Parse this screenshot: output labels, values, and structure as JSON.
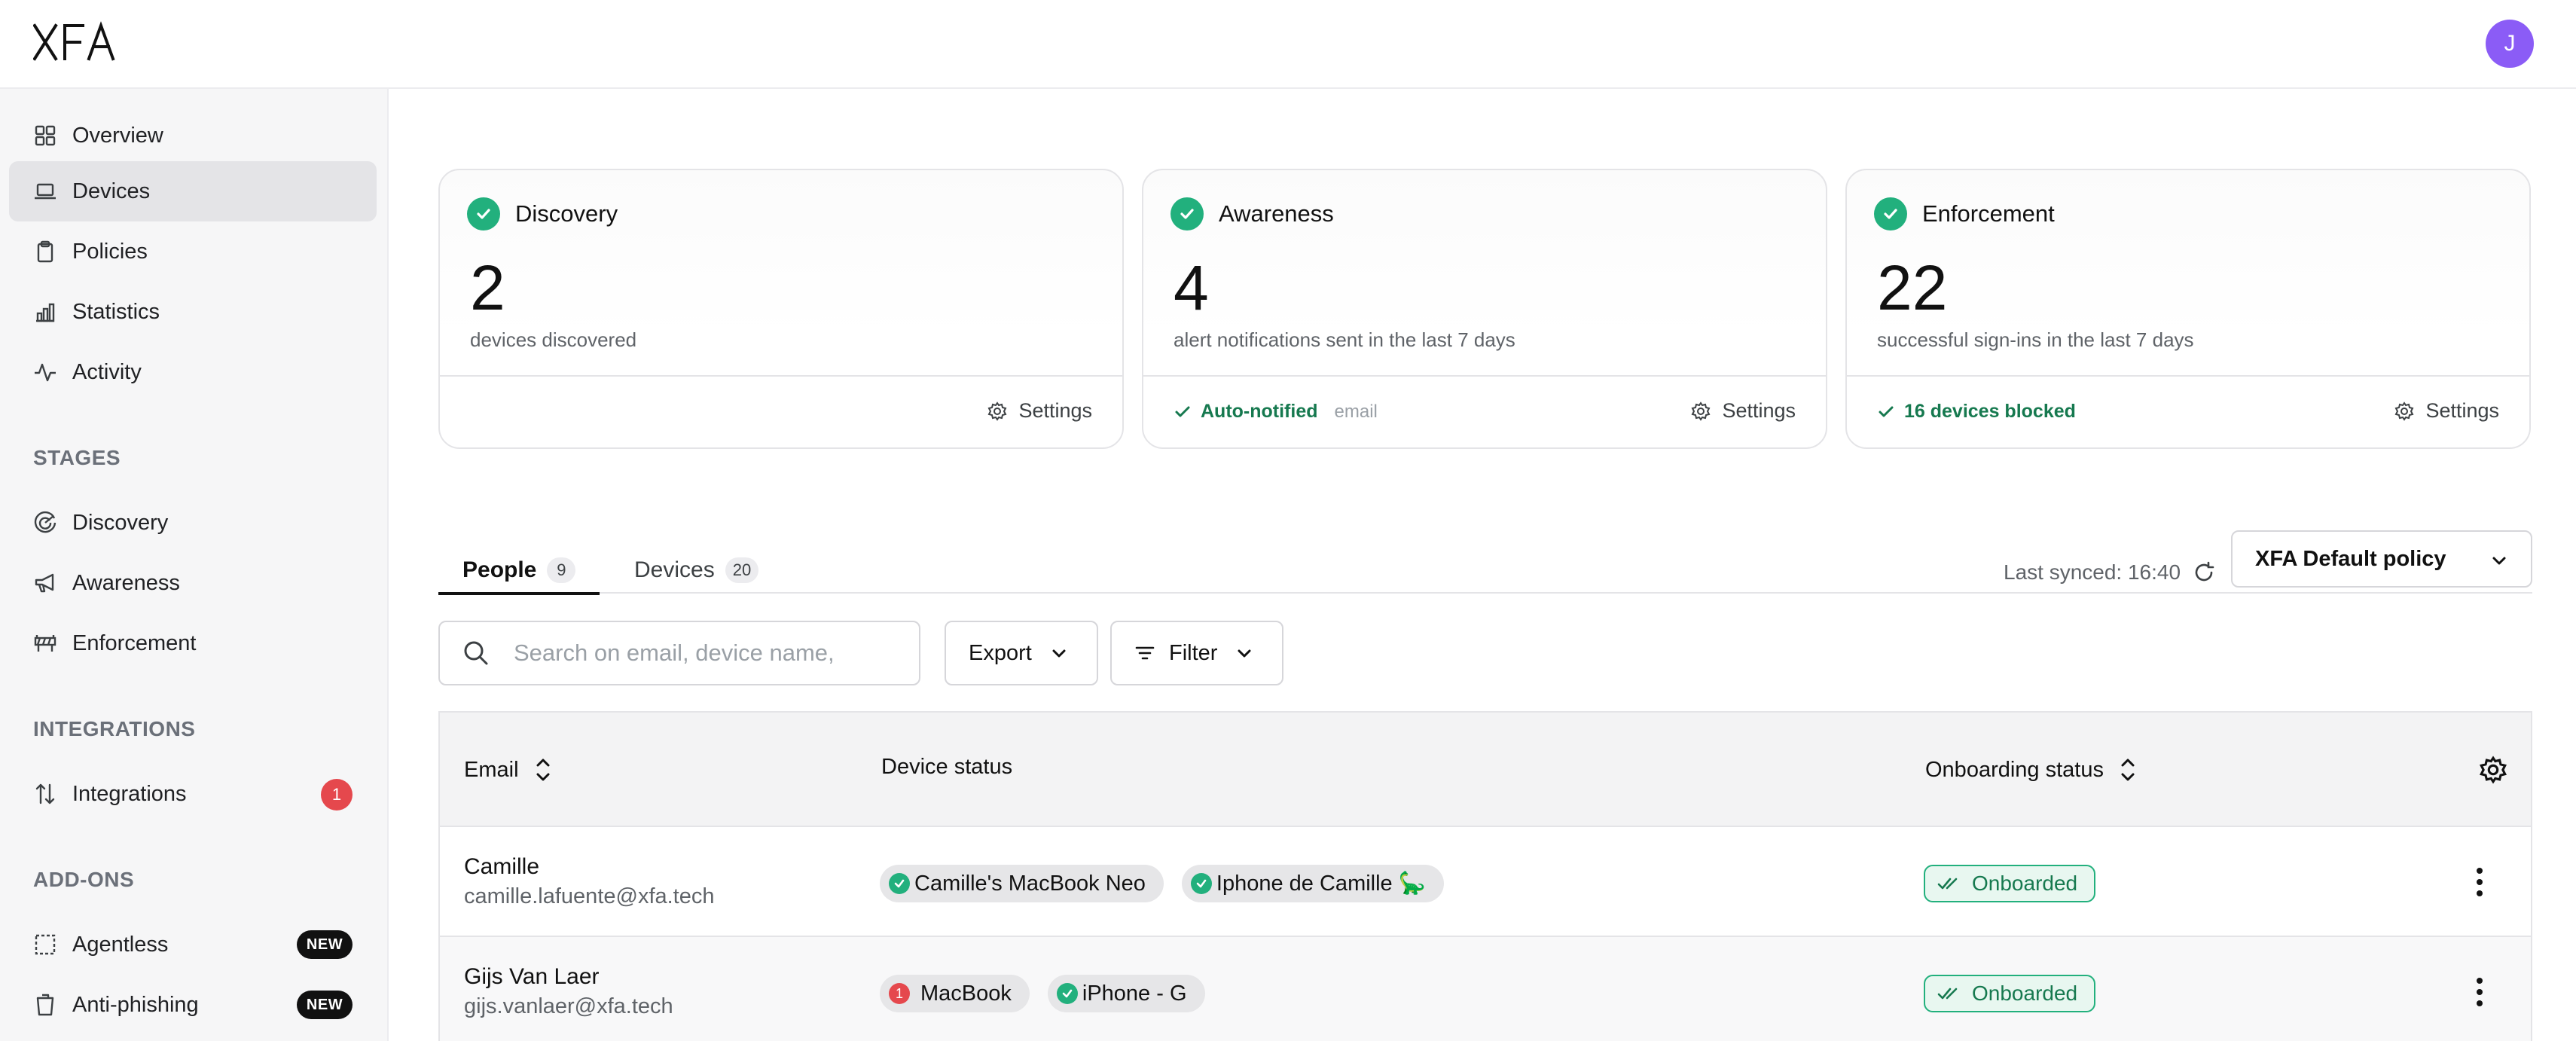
{
  "app": {
    "logo_text": "XFA",
    "avatar_initial": "J"
  },
  "sidebar": {
    "items": [
      {
        "label": "Overview",
        "icon": "grid-icon"
      },
      {
        "label": "Devices",
        "icon": "laptop-icon",
        "active": true
      },
      {
        "label": "Policies",
        "icon": "clipboard-icon"
      },
      {
        "label": "Statistics",
        "icon": "bar-chart-icon"
      },
      {
        "label": "Activity",
        "icon": "activity-icon"
      }
    ],
    "stages_heading": "STAGES",
    "stages": [
      {
        "label": "Discovery",
        "icon": "radar-icon"
      },
      {
        "label": "Awareness",
        "icon": "megaphone-icon"
      },
      {
        "label": "Enforcement",
        "icon": "barrier-icon"
      }
    ],
    "integrations_heading": "INTEGRATIONS",
    "integrations": [
      {
        "label": "Integrations",
        "icon": "arrows-updown-icon",
        "badge": "1"
      }
    ],
    "addons_heading": "ADD-ONS",
    "addons": [
      {
        "label": "Agentless",
        "icon": "dashed-square-icon",
        "badge": "NEW"
      },
      {
        "label": "Anti-phishing",
        "icon": "bin-icon",
        "badge": "NEW"
      }
    ]
  },
  "cards": [
    {
      "title": "Discovery",
      "value": "2",
      "desc": "devices discovered",
      "settings": "Settings"
    },
    {
      "title": "Awareness",
      "value": "4",
      "desc": "alert notifications sent in the last 7 days",
      "status": "Auto-notified",
      "status_sub": "email",
      "settings": "Settings"
    },
    {
      "title": "Enforcement",
      "value": "22",
      "desc": "successful sign-ins in the last 7 days",
      "status": "16 devices blocked",
      "settings": "Settings"
    }
  ],
  "tabs": [
    {
      "label": "People",
      "count": "9",
      "active": true
    },
    {
      "label": "Devices",
      "count": "20"
    }
  ],
  "sync": {
    "text": "Last synced: 16:40"
  },
  "policy": {
    "selected": "XFA Default policy"
  },
  "toolbar": {
    "search_placeholder": "Search on email, device name,",
    "export_label": "Export",
    "filter_label": "Filter"
  },
  "table": {
    "headers": {
      "email": "Email",
      "device_status": "Device status",
      "onboarding": "Onboarding status"
    },
    "rows": [
      {
        "name": "Camille",
        "email": "camille.lafuente@xfa.tech",
        "devices": [
          {
            "name": "Camille's MacBook Neo",
            "status": "ok"
          },
          {
            "name": "Iphone de Camille 🦕",
            "status": "ok"
          }
        ],
        "onboarding": "Onboarded"
      },
      {
        "name": "Gijs Van Laer",
        "email": "gijs.vanlaer@xfa.tech",
        "devices": [
          {
            "name": "MacBook",
            "status": "issue",
            "issue_count": "1"
          },
          {
            "name": "iPhone - G",
            "status": "ok"
          }
        ],
        "onboarding": "Onboarded"
      }
    ]
  },
  "colors": {
    "accent_green": "#22b07d",
    "avatar": "#8b5cf6",
    "alert_red": "#e5484d"
  }
}
